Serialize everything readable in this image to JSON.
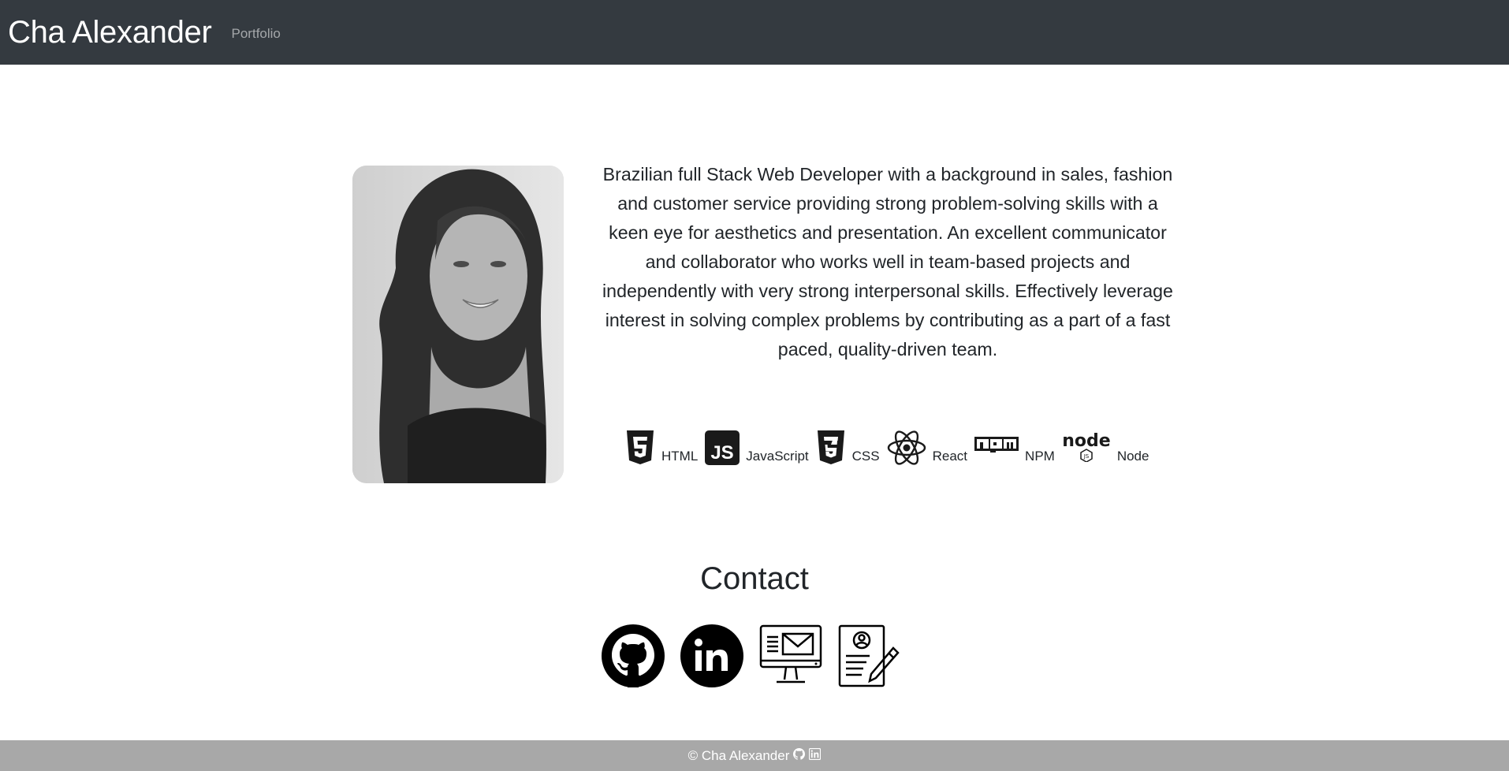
{
  "navbar": {
    "brand": "Cha Alexander",
    "links": [
      {
        "label": "Portfolio"
      }
    ]
  },
  "about": {
    "bio": "Brazilian full Stack Web Developer with a background in sales, fashion and customer service providing strong problem-solving skills with a keen eye for aesthetics and presentation. An excellent communicator and collaborator who works well in team-based projects and independently with very strong interpersonal skills. Effectively leverage interest in solving complex problems by contributing as a part of a fast paced, quality-driven team.",
    "skills": [
      {
        "icon": "html5-icon",
        "label": "HTML"
      },
      {
        "icon": "javascript-icon",
        "label": "JavaScript"
      },
      {
        "icon": "css3-icon",
        "label": "CSS"
      },
      {
        "icon": "react-icon",
        "label": "React"
      },
      {
        "icon": "npm-icon",
        "label": "NPM"
      },
      {
        "icon": "node-icon",
        "label": "Node"
      }
    ]
  },
  "contact": {
    "title": "Contact",
    "links": [
      {
        "icon": "github-icon"
      },
      {
        "icon": "linkedin-icon"
      },
      {
        "icon": "email-icon"
      },
      {
        "icon": "resume-icon"
      }
    ]
  },
  "footer": {
    "text": "© Cha Alexander",
    "icons": [
      "github-icon",
      "linkedin-icon"
    ]
  },
  "colors": {
    "navbar_bg": "#343a40",
    "footer_bg": "#a8a8a8",
    "text": "#212529"
  }
}
